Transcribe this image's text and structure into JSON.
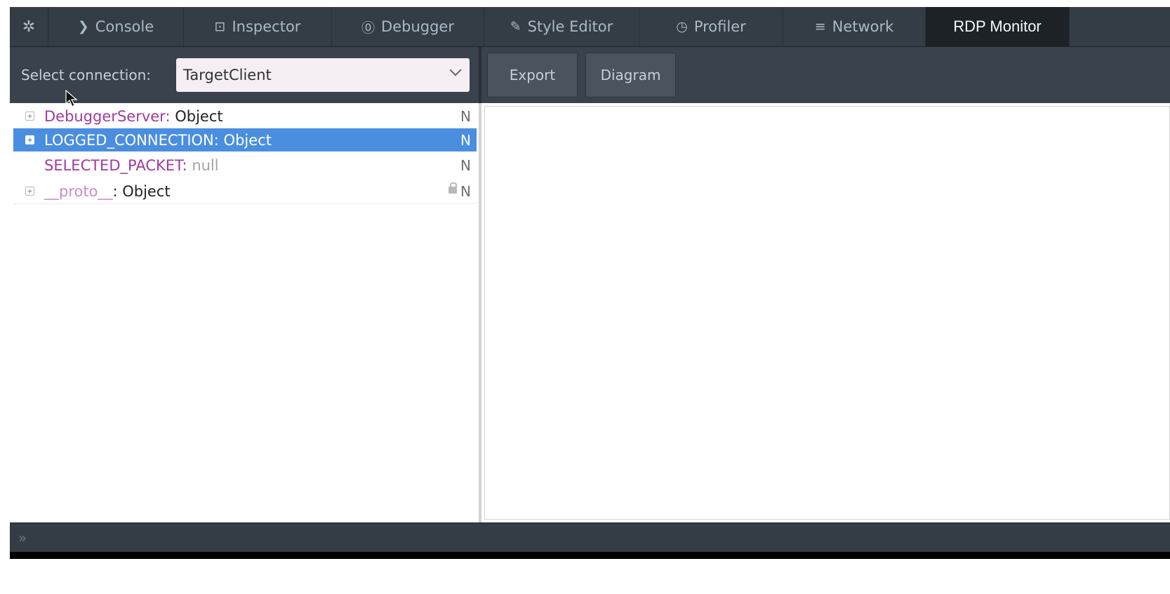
{
  "tabs": [
    {
      "label": "Console",
      "icon": "chevron-right-icon",
      "glyph": "❯"
    },
    {
      "label": "Inspector",
      "icon": "inspector-icon",
      "glyph": "⊡"
    },
    {
      "label": "Debugger",
      "icon": "pause-circle-icon",
      "glyph": "⓪"
    },
    {
      "label": "Style Editor",
      "icon": "pencil-square-icon",
      "glyph": "✎"
    },
    {
      "label": "Profiler",
      "icon": "clock-icon",
      "glyph": "◷"
    },
    {
      "label": "Network",
      "icon": "network-icon",
      "glyph": "≡"
    },
    {
      "label": "RDP Monitor",
      "active": true
    }
  ],
  "toolbar": {
    "select_label": "Select connection:",
    "select_value": "TargetClient",
    "export_label": "Export",
    "diagram_label": "Diagram"
  },
  "tree": {
    "rows": [
      {
        "name": "DebuggerServer",
        "sep": ": ",
        "value": "Object",
        "flag": "N",
        "twisty": "+"
      },
      {
        "name": "LOGGED_CONNECTION",
        "sep": ": ",
        "value": "Object",
        "flag": "N",
        "twisty": "+",
        "selected": true
      },
      {
        "name": "SELECTED_PACKET",
        "sep": ": ",
        "value": "null",
        "flag": "N"
      },
      {
        "name": "__proto__",
        "sep": ": ",
        "value": "Object",
        "flag": "N",
        "twisty": "+",
        "locked": true
      }
    ]
  },
  "console": {
    "prompt": "»"
  },
  "colors": {
    "tabbar": "#343c45",
    "toolbar": "#39424d",
    "selection": "#4a8ee0",
    "property_name": "#a03aa0"
  }
}
